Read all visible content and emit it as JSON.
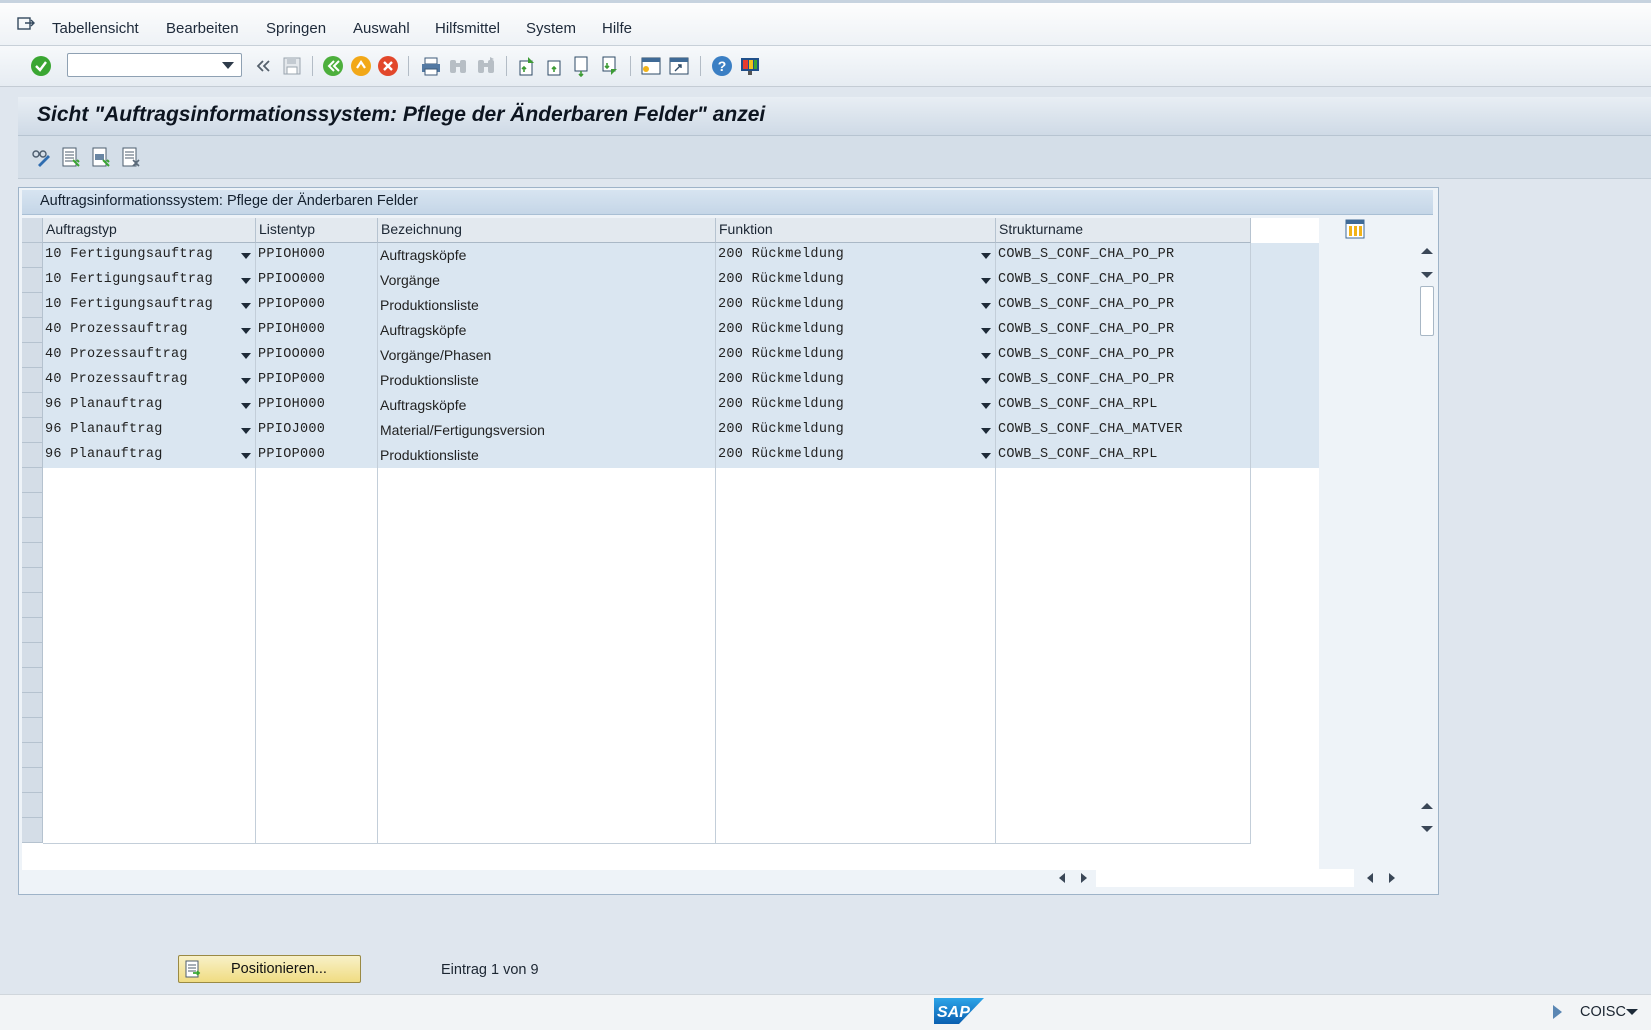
{
  "menu": {
    "items": [
      "Tabellensicht",
      "Bearbeiten",
      "Springen",
      "Auswahl",
      "Hilfsmittel",
      "System",
      "Hilfe"
    ]
  },
  "toolbar": {
    "command_field_value": "",
    "icons": [
      "enter-icon",
      "back-double-icon",
      "save-icon",
      "back-icon",
      "exit-icon",
      "cancel-icon",
      "print-icon",
      "find-icon",
      "find-next-icon",
      "first-page-icon",
      "previous-page-icon",
      "next-page-icon",
      "last-page-icon",
      "create-session-icon",
      "shortcut-icon",
      "help-icon",
      "customize-layout-icon"
    ]
  },
  "page": {
    "title": "Sicht \"Auftragsinformationssystem: Pflege der Änderbaren Felder\" anzei"
  },
  "app_toolbar": {
    "icons": [
      "display-change-icon",
      "select-all-icon",
      "select-block-icon",
      "deselect-all-icon"
    ]
  },
  "table": {
    "caption": "Auftragsinformationssystem: Pflege der Änderbaren Felder",
    "columns": [
      "Auftragstyp",
      "Listentyp",
      "Bezeichnung",
      "Funktion",
      "Strukturname"
    ],
    "rows": [
      {
        "auftragstyp": "10 Fertigungsauftrag",
        "listentyp": "PPIOH000",
        "bezeichnung": "Auftragsköpfe",
        "funktion": "200 Rückmeldung",
        "strukturname": "COWB_S_CONF_CHA_PO_PR"
      },
      {
        "auftragstyp": "10 Fertigungsauftrag",
        "listentyp": "PPIOO000",
        "bezeichnung": "Vorgänge",
        "funktion": "200 Rückmeldung",
        "strukturname": "COWB_S_CONF_CHA_PO_PR"
      },
      {
        "auftragstyp": "10 Fertigungsauftrag",
        "listentyp": "PPIOP000",
        "bezeichnung": "Produktionsliste",
        "funktion": "200 Rückmeldung",
        "strukturname": "COWB_S_CONF_CHA_PO_PR"
      },
      {
        "auftragstyp": "40 Prozessauftrag",
        "listentyp": "PPIOH000",
        "bezeichnung": "Auftragsköpfe",
        "funktion": "200 Rückmeldung",
        "strukturname": "COWB_S_CONF_CHA_PO_PR"
      },
      {
        "auftragstyp": "40 Prozessauftrag",
        "listentyp": "PPIOO000",
        "bezeichnung": "Vorgänge/Phasen",
        "funktion": "200 Rückmeldung",
        "strukturname": "COWB_S_CONF_CHA_PO_PR"
      },
      {
        "auftragstyp": "40 Prozessauftrag",
        "listentyp": "PPIOP000",
        "bezeichnung": "Produktionsliste",
        "funktion": "200 Rückmeldung",
        "strukturname": "COWB_S_CONF_CHA_PO_PR"
      },
      {
        "auftragstyp": "96 Planauftrag",
        "listentyp": "PPIOH000",
        "bezeichnung": "Auftragsköpfe",
        "funktion": "200 Rückmeldung",
        "strukturname": "COWB_S_CONF_CHA_RPL"
      },
      {
        "auftragstyp": "96 Planauftrag",
        "listentyp": "PPIOJ000",
        "bezeichnung": "Material/Fertigungsversion",
        "funktion": "200 Rückmeldung",
        "strukturname": "COWB_S_CONF_CHA_MATVER"
      },
      {
        "auftragstyp": "96 Planauftrag",
        "listentyp": "PPIOP000",
        "bezeichnung": "Produktionsliste",
        "funktion": "200 Rückmeldung",
        "strukturname": "COWB_S_CONF_CHA_RPL"
      }
    ]
  },
  "footer": {
    "position_button_label": "Positionieren...",
    "entry_info": "Eintrag 1 von 9"
  },
  "statusbar": {
    "logo_text": "SAP",
    "system": "COISC"
  },
  "colors": {
    "accent_ok": "#3aa632",
    "row_fill": "#dae6f1",
    "header_bg": "#e3e9ef"
  }
}
